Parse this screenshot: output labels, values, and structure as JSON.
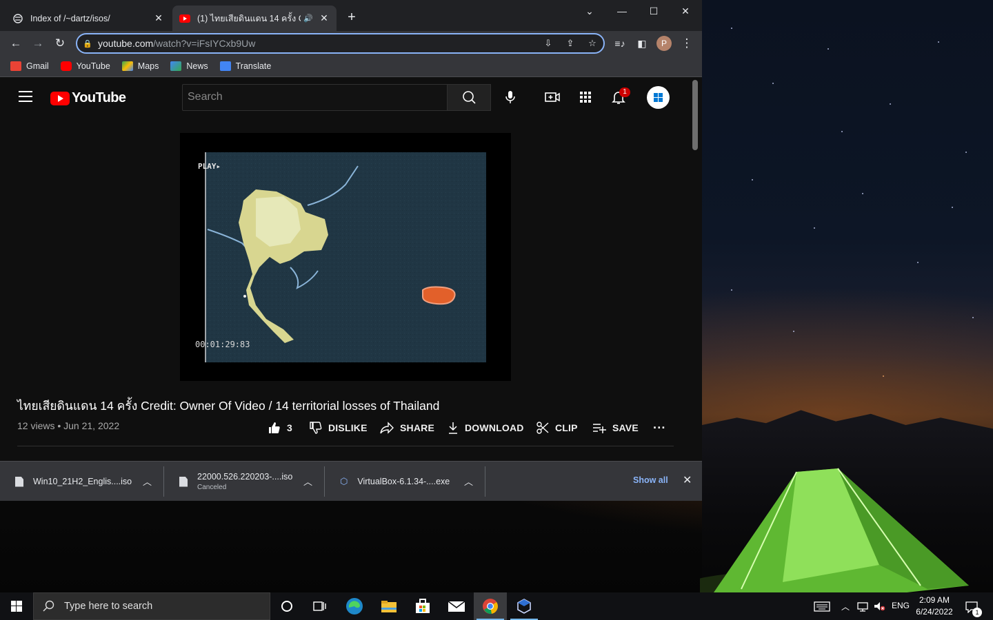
{
  "browser": {
    "tabs": [
      {
        "title": "Index of /~dartz/isos/",
        "active": false
      },
      {
        "title": "(1) ไทยเสียดินแดน 14 ครั้ง Credi",
        "active": true,
        "audio": true
      }
    ],
    "url_host": "youtube.com",
    "url_path": "/watch?v=iFsIYCxb9Uw",
    "bookmarks": [
      {
        "label": "Gmail",
        "icon": "gmail-icon",
        "color": "#ea4335"
      },
      {
        "label": "YouTube",
        "icon": "youtube-icon",
        "color": "#ff0000"
      },
      {
        "label": "Maps",
        "icon": "maps-icon",
        "color": "#34a853"
      },
      {
        "label": "News",
        "icon": "news-icon",
        "color": "#4285f4"
      },
      {
        "label": "Translate",
        "icon": "translate-icon",
        "color": "#4285f4"
      }
    ],
    "profile_initial": "P"
  },
  "youtube": {
    "logo_text": "YouTube",
    "search_placeholder": "Search",
    "notification_count": "1",
    "player": {
      "overlay_label": "PLAY▸",
      "timecode": "00:01:29:83"
    },
    "video": {
      "title": "ไทยเสียดินแดน 14 ครั้ง Credit: Owner Of Video / 14 territorial losses of Thailand",
      "meta": "12 views • Jun 21, 2022",
      "like_count": "3",
      "actions": {
        "dislike": "DISLIKE",
        "share": "SHARE",
        "download": "DOWNLOAD",
        "clip": "CLIP",
        "save": "SAVE"
      }
    }
  },
  "downloads": {
    "items": [
      {
        "name": "Win10_21H2_Englis....iso",
        "status": ""
      },
      {
        "name": "22000.526.220203-....iso",
        "status": "Canceled"
      },
      {
        "name": "VirtualBox-6.1.34-....exe",
        "status": ""
      }
    ],
    "show_all": "Show all"
  },
  "taskbar": {
    "search_placeholder": "Type here to search",
    "language": "ENG",
    "time": "2:09 AM",
    "date": "6/24/2022",
    "notification_count": "1"
  },
  "colors": {
    "accent_blue": "#8ab4f8",
    "youtube_red": "#ff0000",
    "tent_green": "#7fd64a"
  }
}
